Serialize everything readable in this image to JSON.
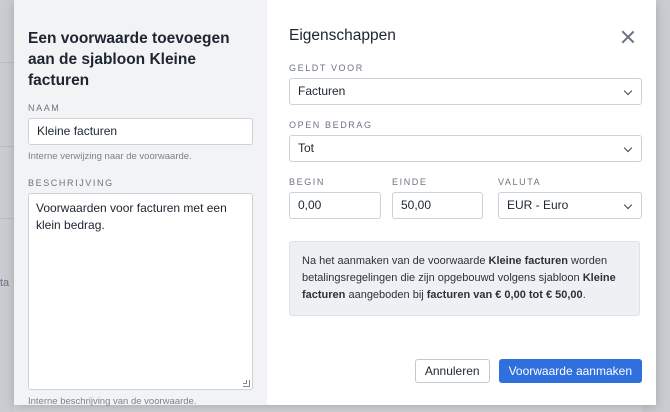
{
  "background": {
    "partial_text": "ta"
  },
  "left_panel": {
    "title": "Een voorwaarde toevoegen aan de sjabloon Kleine facturen",
    "name_label": "NAAM",
    "name_value": "Kleine facturen",
    "name_help": "Interne verwijzing naar de voorwaarde.",
    "description_label": "BESCHRIJVING",
    "description_value": "Voorwaarden voor facturen met een klein bedrag.",
    "description_help": "Interne beschrijving van de voorwaarde."
  },
  "right_panel": {
    "title": "Eigenschappen",
    "applies_label": "GELDT VOOR",
    "applies_value": "Facturen",
    "open_amount_label": "OPEN BEDRAG",
    "open_amount_value": "Tot",
    "begin_label": "BEGIN",
    "begin_value": "0,00",
    "end_label": "EINDE",
    "end_value": "50,00",
    "currency_label": "VALUTA",
    "currency_value": "EUR - Euro",
    "info": {
      "t1": "Na het aanmaken van de voorwaarde ",
      "b1": "Kleine facturen",
      "t2": " worden betalingsregelingen die zijn opgebouwd volgens sjabloon ",
      "b2": "Kleine facturen",
      "t3": " aangeboden bij ",
      "b3": "facturen van € 0,00 tot € 50,00",
      "t4": "."
    }
  },
  "footer": {
    "cancel_label": "Annuleren",
    "create_label": "Voorwaarde aanmaken"
  },
  "colors": {
    "primary": "#2f6fde",
    "left_panel_bg": "#f2f3f5"
  },
  "icons": {
    "close": "close-icon",
    "dropdown": "chevron-down-icon"
  }
}
